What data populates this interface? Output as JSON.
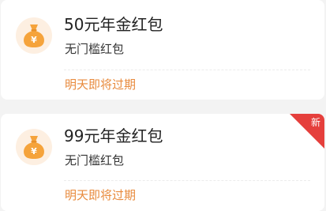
{
  "colors": {
    "accent": "#e88a3c",
    "icon_bg": "#fdefe1",
    "icon_bag": "#f5a33b",
    "badge_red": "#e53f3c"
  },
  "coupons": [
    {
      "title": "50元年金红包",
      "subtitle": "无门槛红包",
      "expiry": "明天即将过期",
      "icon": "money-bag-icon"
    },
    {
      "title": "99元年金红包",
      "subtitle": "无门槛红包",
      "expiry": "明天即将过期",
      "icon": "money-bag-icon",
      "badge": "新"
    }
  ]
}
